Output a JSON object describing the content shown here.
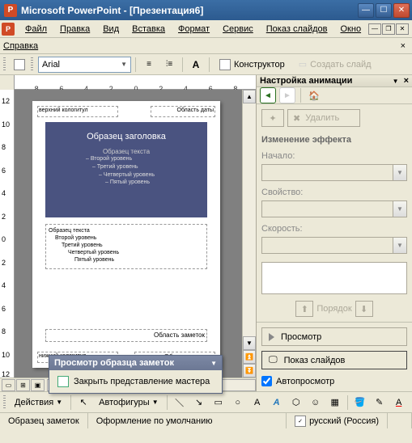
{
  "window": {
    "app_name": "Microsoft PowerPoint",
    "doc_name": "[Презентация6]",
    "full_title": "Microsoft PowerPoint - [Презентация6]"
  },
  "menu": {
    "file": "Файл",
    "edit": "Правка",
    "view": "Вид",
    "insert": "Вставка",
    "format": "Формат",
    "tools": "Сервис",
    "slideshow": "Показ слайдов",
    "window": "Окно",
    "help": "Справка"
  },
  "toolbar": {
    "font_name": "Arial",
    "designer": "Конструктор",
    "new_slide": "Создать слайд"
  },
  "ruler": {
    "h_ticks": [
      "8",
      "6",
      "4",
      "2",
      "0",
      "2",
      "4",
      "6",
      "8"
    ],
    "v_ticks": [
      "12",
      "10",
      "8",
      "6",
      "4",
      "2",
      "0",
      "2",
      "4",
      "6",
      "8",
      "10",
      "12"
    ]
  },
  "master": {
    "header_ph": "верхний кологитул",
    "date_ph": "Область даты",
    "slide_title": "Образец заголовка",
    "slide_sub": "Образец текста",
    "levels": [
      "Второй уровень",
      "Третий уровень",
      "Четвертый уровень",
      "Пятый уровень"
    ],
    "outline_title": "Образец текста",
    "outline_levels": [
      "Второй уровень",
      "Третий уровень",
      "Четвертый уровень",
      "Пятый уровень"
    ],
    "notes_ph": "Область заметок",
    "footer_ph": "нижний кологитул",
    "num_ph": "Область номера"
  },
  "floating": {
    "title": "Просмотр образца заметок",
    "close_btn": "Закрыть представление мастера"
  },
  "taskpane": {
    "title": "Настройка анимации",
    "delete": "Удалить",
    "effect_section": "Изменение эффекта",
    "start_label": "Начало:",
    "property_label": "Свойство:",
    "speed_label": "Скорость:",
    "order_label": "Порядок",
    "preview": "Просмотр",
    "slideshow": "Показ слайдов",
    "autopreview": "Автопросмотр"
  },
  "drawbar": {
    "actions": "Действия",
    "autoshapes": "Автофигуры"
  },
  "status": {
    "master": "Образец заметок",
    "design": "Оформление по умолчанию",
    "lang": "русский (Россия)"
  }
}
